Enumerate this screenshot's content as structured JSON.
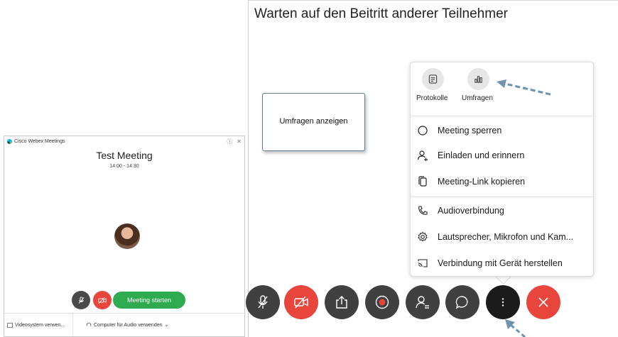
{
  "small_window": {
    "title": "Cisco Webex Meetings",
    "meeting_title": "Test Meeting",
    "meeting_time": "14:00 - 14:30",
    "start_button": "Meeting starten",
    "video_system": "Videosystem verwen...",
    "audio_option": "Computer für Audio verwenden",
    "icons": [
      "webex-logo-icon",
      "help-icon",
      "close-icon",
      "mic-icon",
      "camera-off-icon",
      "cast-icon",
      "headset-icon",
      "chevron-down-icon"
    ]
  },
  "main": {
    "heading": "Warten auf den Beitritt anderer Teilnehmer",
    "callout": "Umfragen anzeigen"
  },
  "menu": {
    "top_items": [
      {
        "label": "Protokolle",
        "icon": "notes-icon"
      },
      {
        "label": "Umfragen",
        "icon": "polls-icon"
      }
    ],
    "items": [
      {
        "label": "Meeting sperren",
        "icon": "lock-meeting-icon"
      },
      {
        "label": "Einladen und erinnern",
        "icon": "invite-user-icon"
      },
      {
        "label": "Meeting-Link kopieren",
        "icon": "copy-icon"
      },
      {
        "label": "Audioverbindung",
        "icon": "phone-icon"
      },
      {
        "label": "Lautsprecher, Mikrofon und Kam...",
        "icon": "settings-gear-icon"
      },
      {
        "label": "Verbindung mit Gerät herstellen",
        "icon": "cast-device-icon"
      }
    ]
  },
  "controls": [
    {
      "name": "mute-button",
      "icon": "mic-icon"
    },
    {
      "name": "video-button",
      "icon": "camera-off-icon"
    },
    {
      "name": "share-button",
      "icon": "share-icon"
    },
    {
      "name": "record-button",
      "icon": "record-icon"
    },
    {
      "name": "participants-button",
      "icon": "participants-icon"
    },
    {
      "name": "chat-button",
      "icon": "chat-icon"
    },
    {
      "name": "more-button",
      "icon": "more-options-icon"
    },
    {
      "name": "leave-button",
      "icon": "leave-icon"
    }
  ],
  "colors": {
    "start_green": "#2eaa4f",
    "alert_red": "#e8453c",
    "control_dark": "#404040",
    "arrow_blue": "#6f93ad"
  }
}
